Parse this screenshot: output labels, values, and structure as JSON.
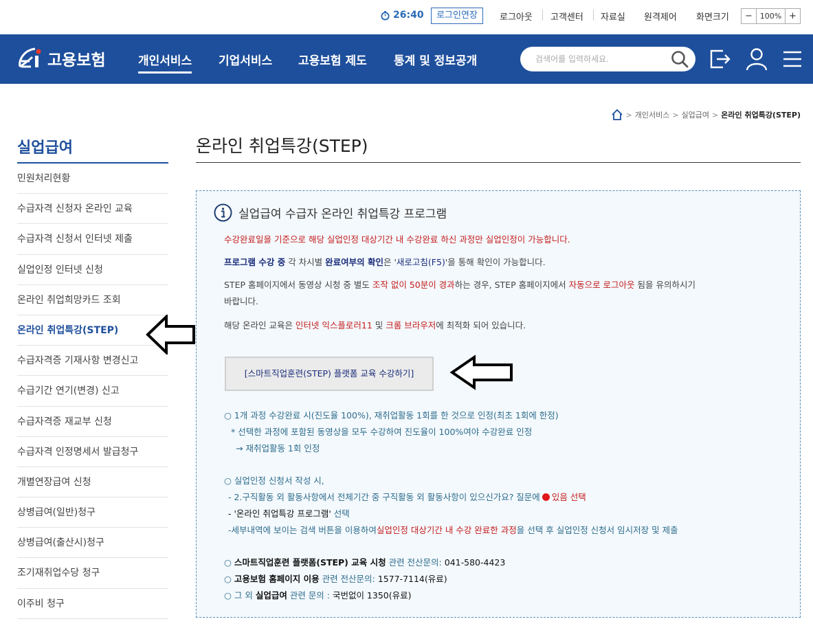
{
  "util": {
    "timer": "26:40",
    "extend_btn": "로그인연장",
    "links": [
      "로그아웃",
      "고객센터",
      "자료실",
      "원격제어",
      "화면크기"
    ],
    "zoom_minus": "−",
    "zoom_value": "100%",
    "zoom_plus": "+"
  },
  "header": {
    "logo_text": "고용보험",
    "nav": [
      "개인서비스",
      "기업서비스",
      "고용보험 제도",
      "통계 및 정보공개"
    ],
    "search_placeholder": "검색어를 입력하세요."
  },
  "breadcrumb": [
    "개인서비스",
    "실업급여",
    "온라인 취업특강(STEP)"
  ],
  "lnb": {
    "title": "실업급여",
    "items": [
      "민원처리현황",
      "수급자격 신청자 온라인 교육",
      "수급자격 신청서 인터넷 제출",
      "실업인정 인터넷 신청",
      "온라인 취업희망카드 조회",
      "온라인 취업특강(STEP)",
      "수급자격증 기재사항 변경신고",
      "수급기간 연기(변경) 신고",
      "수급자격증 재교부 신청",
      "수급자격 인정명세서 발급청구",
      "개별연장급여 신청",
      "상병급여(일반)청구",
      "상병급여(출산시)청구",
      "조기재취업수당 청구",
      "이주비 청구"
    ]
  },
  "content": {
    "page_title": "온라인 취업특강(STEP)",
    "box_title": "실업급여 수급자 온라인 취업특강 프로그램",
    "p1": "수강완료일을 기준으로 해당 실업인정 대상기간 내 수강완료 하신 과정만 실업인정이 가능합니다.",
    "p2": {
      "a": "프로그램 수강 중",
      "b": " 각 차시별 ",
      "c": "완료여부의 확인",
      "d": "은 '",
      "e": "새로고침(F5)",
      "f": "'을 통해 확인이 가능합니다."
    },
    "p3": {
      "a": "STEP 홈페이지에서 동영상 시청 중 별도 ",
      "b": "조작 없이 50분이 경과",
      "c": "하는 경우, STEP 홈페이지에서 ",
      "d": "자동으로 로그아웃",
      "e": " 됨을 유의하시기",
      "f": "바랍니다."
    },
    "p4": {
      "a": "해당 온라인 교육은 ",
      "b": "인터넷 익스플로러11",
      "c": " 및 ",
      "d": "크롬 브라우저",
      "e": "에 최적화 되어 있습니다."
    },
    "step_button": "[스마트직업훈련(STEP) 플랫폼 교육 수강하기]",
    "g1": {
      "l1": "○ 1개 과정 수강완료 시(진도율 100%), 재취업활동 1회를 한 것으로 인정(최초 1회에 한정)",
      "l2": "* 선택한 과정에 포함된 동영상을 모두 수강하여 진도율이 100%여야 수강완료 인정",
      "l3": "→ 재취업활동 1회 인정"
    },
    "g2": {
      "l1": "○ 실업인정 신청서 작성 시,",
      "l2a": "- 2.구직활동 외 활동사항에서 전체기간 중 구직활동 외 활동사항이 있으신가요? 질문에",
      "l2b": "있음 선택",
      "l3a": "- '온라인 취업특강 프로그램'",
      "l3b": " 선택",
      "l4a": "-세부내역에 보이는 검색 버튼을 이용하여",
      "l4b": "실업인정 대상기간 내 수강 완료한 과정",
      "l4c": "을 선택 후 실업인정 신청서 임시저장 및 제출"
    },
    "g3": {
      "l1a": "○ ",
      "l1b": "스마트직업훈련 플랫폼(STEP) 교육 시청",
      "l1c": " 관련 전산문의: ",
      "l1d": "041-580-4423",
      "l2a": "○ ",
      "l2b": "고용보험 홈페이지 이용",
      "l2c": " 관련 전산문의: ",
      "l2d": "1577-7114(유료)",
      "l3a": "○ 그 외 ",
      "l3b": "실업급여",
      "l3c": " 관련 문의 : ",
      "l3d": "국번없이 1350(유료)"
    }
  }
}
